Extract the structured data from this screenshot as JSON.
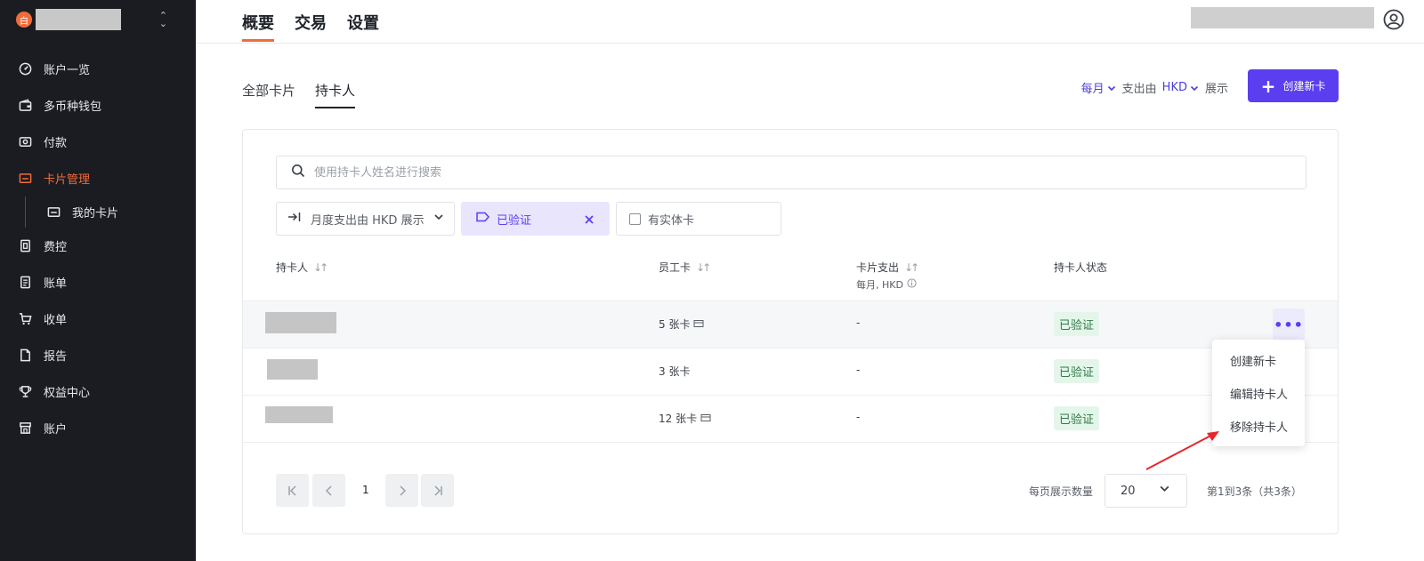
{
  "sidebar": {
    "brand_logo_glyph": "白",
    "items": [
      {
        "label": "账户一览",
        "icon": "gauge-icon"
      },
      {
        "label": "多币种钱包",
        "icon": "wallet-icon"
      },
      {
        "label": "付款",
        "icon": "payment-icon"
      },
      {
        "label": "卡片管理",
        "icon": "card-icon",
        "active": true
      },
      {
        "label": "我的卡片",
        "icon": "card-icon",
        "sub": true
      },
      {
        "label": "费控",
        "icon": "expense-icon"
      },
      {
        "label": "账单",
        "icon": "bill-icon"
      },
      {
        "label": "收单",
        "icon": "cart-icon"
      },
      {
        "label": "报告",
        "icon": "report-icon"
      },
      {
        "label": "权益中心",
        "icon": "trophy-icon"
      },
      {
        "label": "账户",
        "icon": "store-icon"
      }
    ]
  },
  "header": {
    "tabs": [
      "概要",
      "交易",
      "设置"
    ],
    "active_tab": "概要"
  },
  "subtabs": {
    "all_cards": "全部卡片",
    "cardholders": "持卡人"
  },
  "spend_control": {
    "period": "每月",
    "spend_by": "支出由",
    "currency": "HKD",
    "show": "展示"
  },
  "create_button": "创建新卡",
  "search": {
    "placeholder": "使用持卡人姓名进行搜索"
  },
  "filters": {
    "spend": "月度支出由 HKD 展示",
    "verified": "已验证",
    "physical": "有实体卡"
  },
  "table": {
    "columns": {
      "holder": "持卡人",
      "employee_cards": "员工卡",
      "card_spend": "卡片支出",
      "card_spend_sub": "每月, HKD",
      "status": "持卡人状态"
    },
    "rows": [
      {
        "cards": "5 张卡",
        "spend": "-",
        "status": "已验证",
        "physical": true
      },
      {
        "cards": "3 张卡",
        "spend": "-",
        "status": "已验证",
        "physical": false
      },
      {
        "cards": "12 张卡",
        "spend": "-",
        "status": "已验证",
        "physical": true
      }
    ]
  },
  "row_menu": {
    "items": [
      "创建新卡",
      "编辑持卡人",
      "移除持卡人"
    ]
  },
  "pagination": {
    "current_page": "1",
    "per_page_label": "每页展示数量",
    "per_page": "20",
    "range_text": "第1到3条（共3条）"
  },
  "colors": {
    "accent": "#5b3ef0",
    "brand": "#f26b3a",
    "sidebar_bg": "#1a1c21",
    "success": "#2f7a48",
    "annotation_arrow": "#e8262b"
  }
}
